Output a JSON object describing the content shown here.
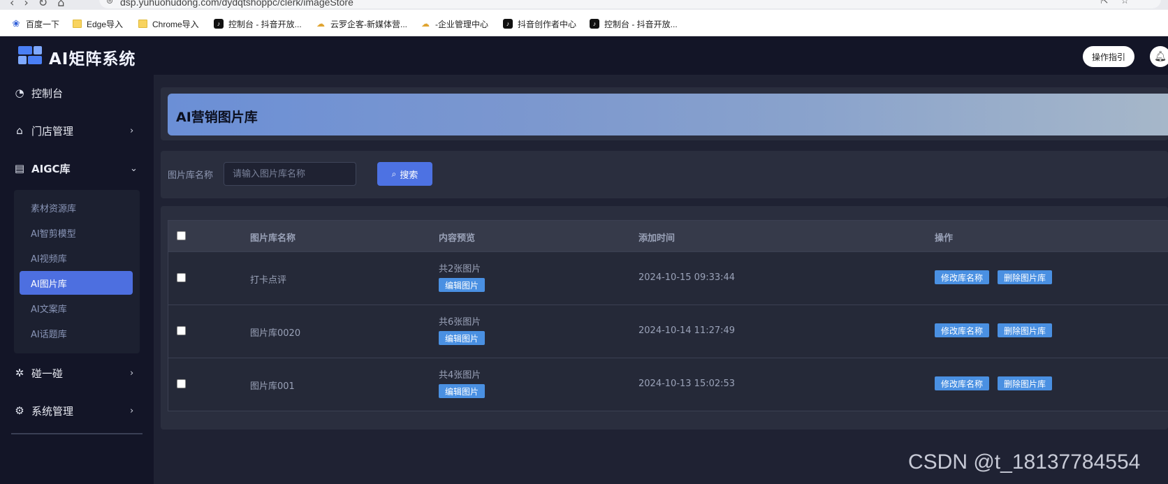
{
  "browser": {
    "url": "dsp.yuhuohudong.com/dydqtshoppc/clerk/imageStore",
    "bookmarks": [
      {
        "label": "百度一下",
        "icon": "baidu-paw-icon"
      },
      {
        "label": "Edge导入",
        "icon": "folder-icon"
      },
      {
        "label": "Chrome导入",
        "icon": "folder-icon"
      },
      {
        "label": "控制台 - 抖音开放...",
        "icon": "tiktok-icon"
      },
      {
        "label": "云罗企客-新媒体营...",
        "icon": "cloud-icon"
      },
      {
        "label": "-企业管理中心",
        "icon": "cloud-icon"
      },
      {
        "label": "抖音创作者中心",
        "icon": "tiktok-icon"
      },
      {
        "label": "控制台 - 抖音开放...",
        "icon": "tiktok-icon"
      }
    ]
  },
  "header": {
    "app_title": "AI矩阵系统",
    "guide_label": "操作指引"
  },
  "sidebar": {
    "items": [
      {
        "label": "控制台",
        "icon": "dashboard-icon"
      },
      {
        "label": "门店管理",
        "icon": "store-icon"
      },
      {
        "label": "AIGC库",
        "icon": "printer-icon"
      },
      {
        "label": "碰一碰",
        "icon": "tap-icon"
      },
      {
        "label": "系统管理",
        "icon": "gear-icon"
      }
    ],
    "sub_items": [
      {
        "label": "素材资源库"
      },
      {
        "label": "AI智剪模型"
      },
      {
        "label": "AI视频库"
      },
      {
        "label": "AI图片库"
      },
      {
        "label": "AI文案库"
      },
      {
        "label": "AI话题库"
      }
    ]
  },
  "page": {
    "title": "AI营销图片库"
  },
  "search": {
    "label": "图片库名称",
    "placeholder": "请输入图片库名称",
    "button_label": "搜索"
  },
  "table": {
    "headers": [
      "图片库名称",
      "内容预览",
      "添加时间",
      "操作"
    ],
    "rows": [
      {
        "name": "打卡点评",
        "count": "共2张图片",
        "edit_label": "编辑图片",
        "time": "2024-10-15 09:33:44",
        "rename_label": "修改库名称",
        "delete_label": "删除图片库"
      },
      {
        "name": "图片库0020",
        "count": "共6张图片",
        "edit_label": "编辑图片",
        "time": "2024-10-14 11:27:49",
        "rename_label": "修改库名称",
        "delete_label": "删除图片库"
      },
      {
        "name": "图片库001",
        "count": "共4张图片",
        "edit_label": "编辑图片",
        "time": "2024-10-13 15:02:53",
        "rename_label": "修改库名称",
        "delete_label": "删除图片库"
      }
    ]
  },
  "watermark": "CSDN @t_18137784554",
  "colors": {
    "sidebar_bg": "#131527",
    "main_bg": "#1f2233",
    "accent": "#4d6fe0",
    "tag_button": "#4a90e2"
  }
}
